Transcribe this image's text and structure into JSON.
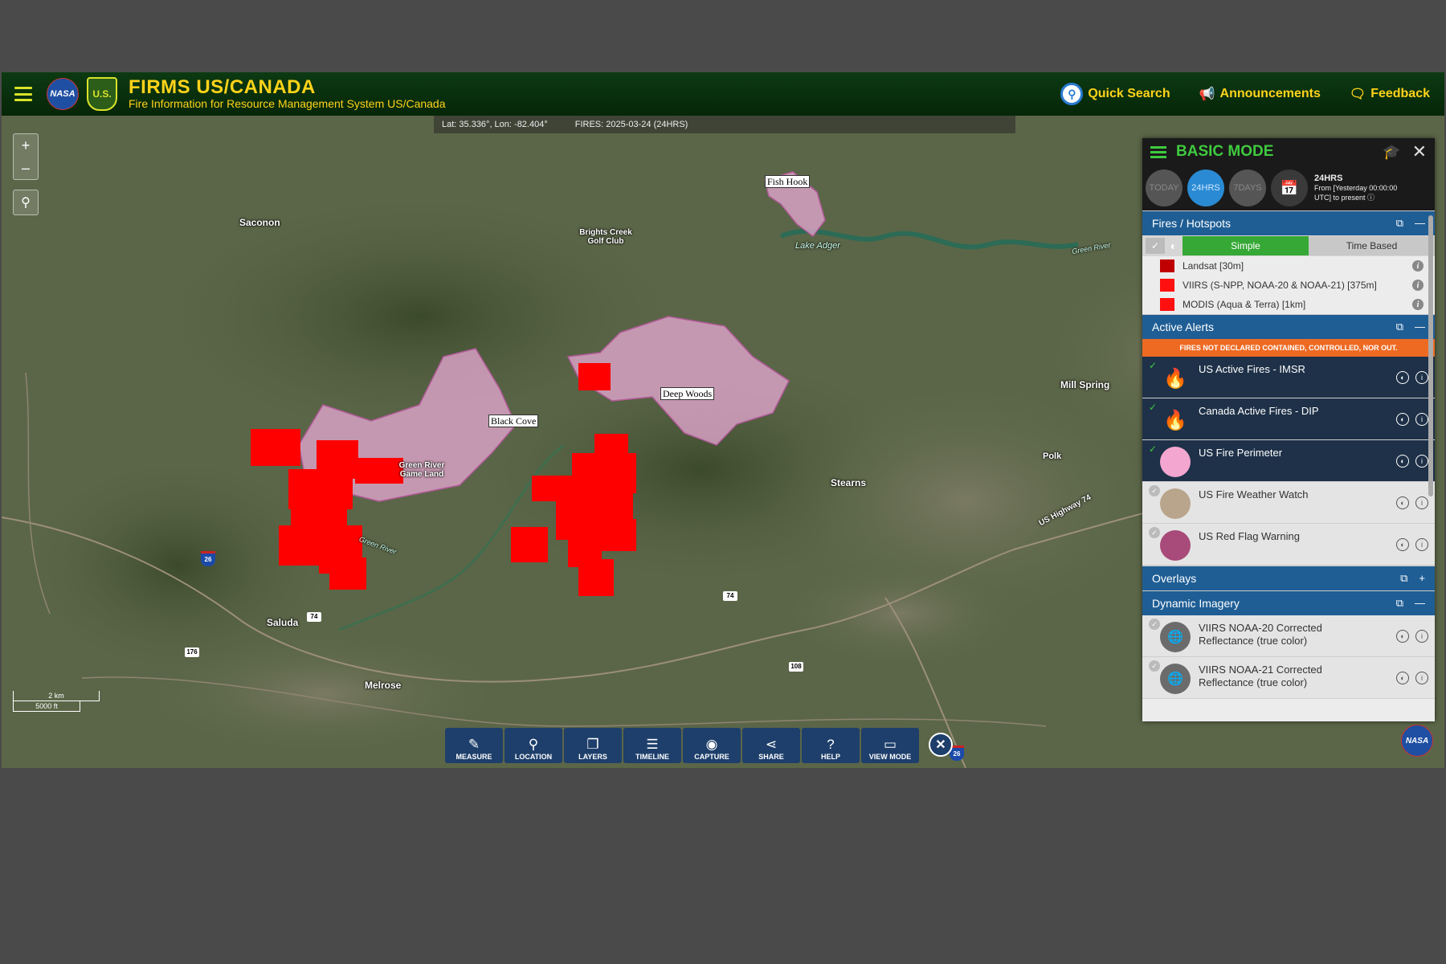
{
  "header": {
    "title": "FIRMS US/CANADA",
    "subtitle": "Fire Information for Resource Management System US/Canada",
    "nasa_logo": "NASA",
    "usfs_logo": "U.S.",
    "quick_search": "Quick Search",
    "announcements": "Announcements",
    "feedback": "Feedback"
  },
  "map": {
    "coords": "Lat: 35.336°, Lon: -82.404°",
    "fires": "FIRES: 2025-03-24 (24HRS)",
    "zoom_in": "+",
    "zoom_out": "–",
    "places": {
      "saconon": "Saconon",
      "brights_creek": "Brights Creek Golf Club",
      "lake_adger": "Lake Adger",
      "green_river": "Green River",
      "green_river_game_land": "Green River Game Land",
      "green_river_2": "Green River",
      "mill_spring": "Mill Spring",
      "polk": "Polk",
      "stearns": "Stearns",
      "us_highway_74": "US Highway 74",
      "saluda": "Saluda",
      "melrose": "Melrose"
    },
    "fire_labels": {
      "fish_hook": "Fish Hook",
      "deep_woods": "Deep Woods",
      "black_cove": "Black Cove"
    },
    "shields": {
      "i26_a": "26",
      "us74_a": "74",
      "us74_b": "74",
      "r176": "176",
      "r108": "108",
      "i26_b": "26"
    },
    "scale_km": "2 km",
    "scale_ft": "5000 ft"
  },
  "toolbar": [
    {
      "label": "MEASURE",
      "icon": "✎",
      "name": "measure-button"
    },
    {
      "label": "LOCATION",
      "icon": "⚲",
      "name": "location-button"
    },
    {
      "label": "LAYERS",
      "icon": "❐",
      "name": "layers-button"
    },
    {
      "label": "TIMELINE",
      "icon": "☰",
      "name": "timeline-button"
    },
    {
      "label": "CAPTURE",
      "icon": "◉",
      "name": "capture-button"
    },
    {
      "label": "SHARE",
      "icon": "⋖",
      "name": "share-button"
    },
    {
      "label": "HELP",
      "icon": "?",
      "name": "help-button"
    },
    {
      "label": "VIEW MODE",
      "icon": "▭",
      "name": "view-mode-button"
    }
  ],
  "toolbar_close": "✕",
  "corner_logo": "NASA",
  "panel": {
    "title": "BASIC MODE",
    "time_buttons": [
      "TODAY",
      "24HRS",
      "7DAYS"
    ],
    "time_info_title": "24HRS",
    "time_info_line1": "From [Yesterday 00:00:00",
    "time_info_line2": "UTC] to present",
    "fires_section": "Fires / Hotspots",
    "mode_simple": "Simple",
    "mode_time": "Time Based",
    "legend": [
      {
        "label": "Landsat [30m]",
        "color": "#c00000"
      },
      {
        "label": "VIIRS (S-NPP, NOAA-20 & NOAA-21) [375m]",
        "color": "#ff1010"
      },
      {
        "label": "MODIS (Aqua & Terra) [1km]",
        "color": "#ff1010"
      }
    ],
    "alerts_section": "Active Alerts",
    "alert_banner": "FIRES NOT DECLARED CONTAINED, CONTROLLED, NOR OUT.",
    "alert_layers": [
      {
        "label": "US Active Fires - IMSR"
      },
      {
        "label": "Canada Active Fires - DIP"
      },
      {
        "label": "US Fire Perimeter"
      },
      {
        "label": "US Fire Weather Watch"
      },
      {
        "label": "US Red Flag Warning"
      }
    ],
    "overlays_section": "Overlays",
    "dynamic_section": "Dynamic Imagery",
    "dynamic_layers": [
      {
        "line1": "VIIRS NOAA-20 Corrected",
        "line2": "Reflectance (true color)"
      },
      {
        "line1": "VIIRS NOAA-21 Corrected",
        "line2": "Reflectance (true color)"
      }
    ]
  },
  "colors": {
    "header_bg": "#0c3a12",
    "header_text": "#ffd31a",
    "perimeter": "#e8a9d4",
    "hotspot": "#ff0000",
    "section_bg": "#1f5e95",
    "alert_orange": "#ee6a23",
    "active_green": "#36a836"
  }
}
